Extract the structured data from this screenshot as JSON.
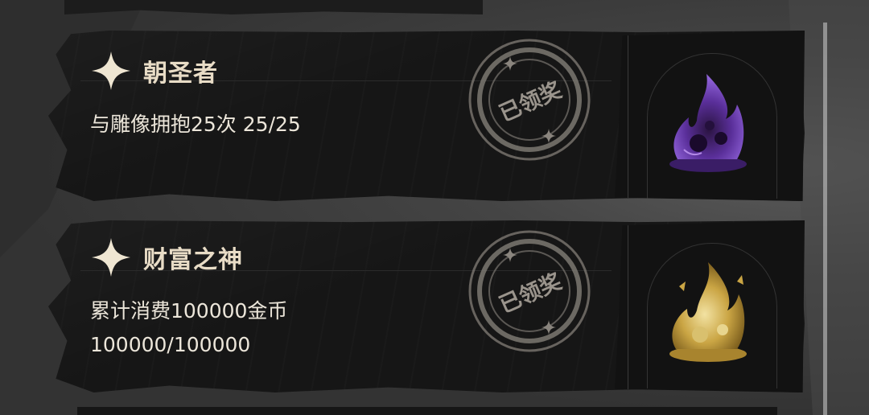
{
  "achievements": [
    {
      "title": "朝圣者",
      "description": "与雕像拥抱25次 25/25",
      "description_line2": "",
      "stamp_text": "已领奖",
      "reward_icon": "purple-flame-icon",
      "reward_color": "#6a3bb0"
    },
    {
      "title": "财富之神",
      "description": "累计消费100000金币",
      "description_line2": "100000/100000",
      "stamp_text": "已领奖",
      "reward_icon": "gold-flame-icon",
      "reward_color": "#c9a63c"
    }
  ],
  "colors": {
    "card": "#161616",
    "title": "#e8dcc6",
    "text": "#ece6da",
    "stamp": "#9a948c"
  }
}
